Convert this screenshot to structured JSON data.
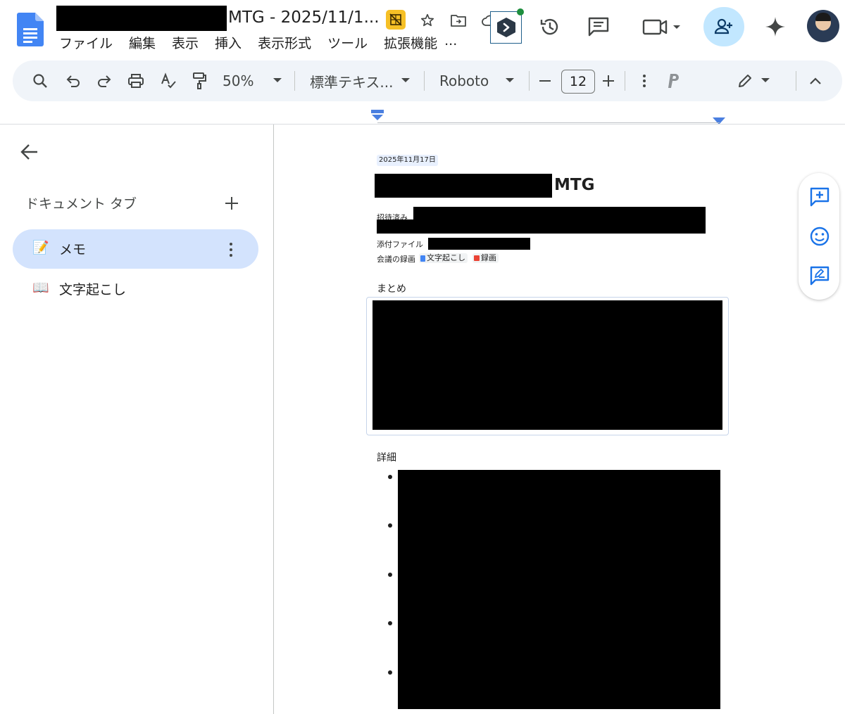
{
  "header": {
    "title_suffix": "MTG - 2025/11/1...",
    "menu": [
      "ファイル",
      "編集",
      "表示",
      "挿入",
      "表示形式",
      "ツール",
      "拡張機能",
      "..."
    ]
  },
  "toolbar": {
    "zoom": "50%",
    "style": "標準テキス...",
    "font": "Roboto",
    "font_size": "12"
  },
  "sidebar": {
    "title": "ドキュメント タブ",
    "tabs": [
      {
        "emoji": "📝",
        "label": "メモ"
      },
      {
        "emoji": "📖",
        "label": "文字起こし"
      }
    ]
  },
  "doc": {
    "date": "2025年11月17日",
    "title_suffix": "MTG",
    "invited_label": "招待済み",
    "attachment_label": "添付ファイル",
    "recording_label": "会議の録画",
    "chip_transcript": "文字起こし",
    "chip_recording": "録画",
    "summary_heading": "まとめ",
    "details_heading": "詳細"
  },
  "colors": {
    "accent": "#1a73e8",
    "selected_tab": "#d3e3fd",
    "share_button": "#c2e7ff",
    "toolbar_bg": "#f0f4f9"
  }
}
